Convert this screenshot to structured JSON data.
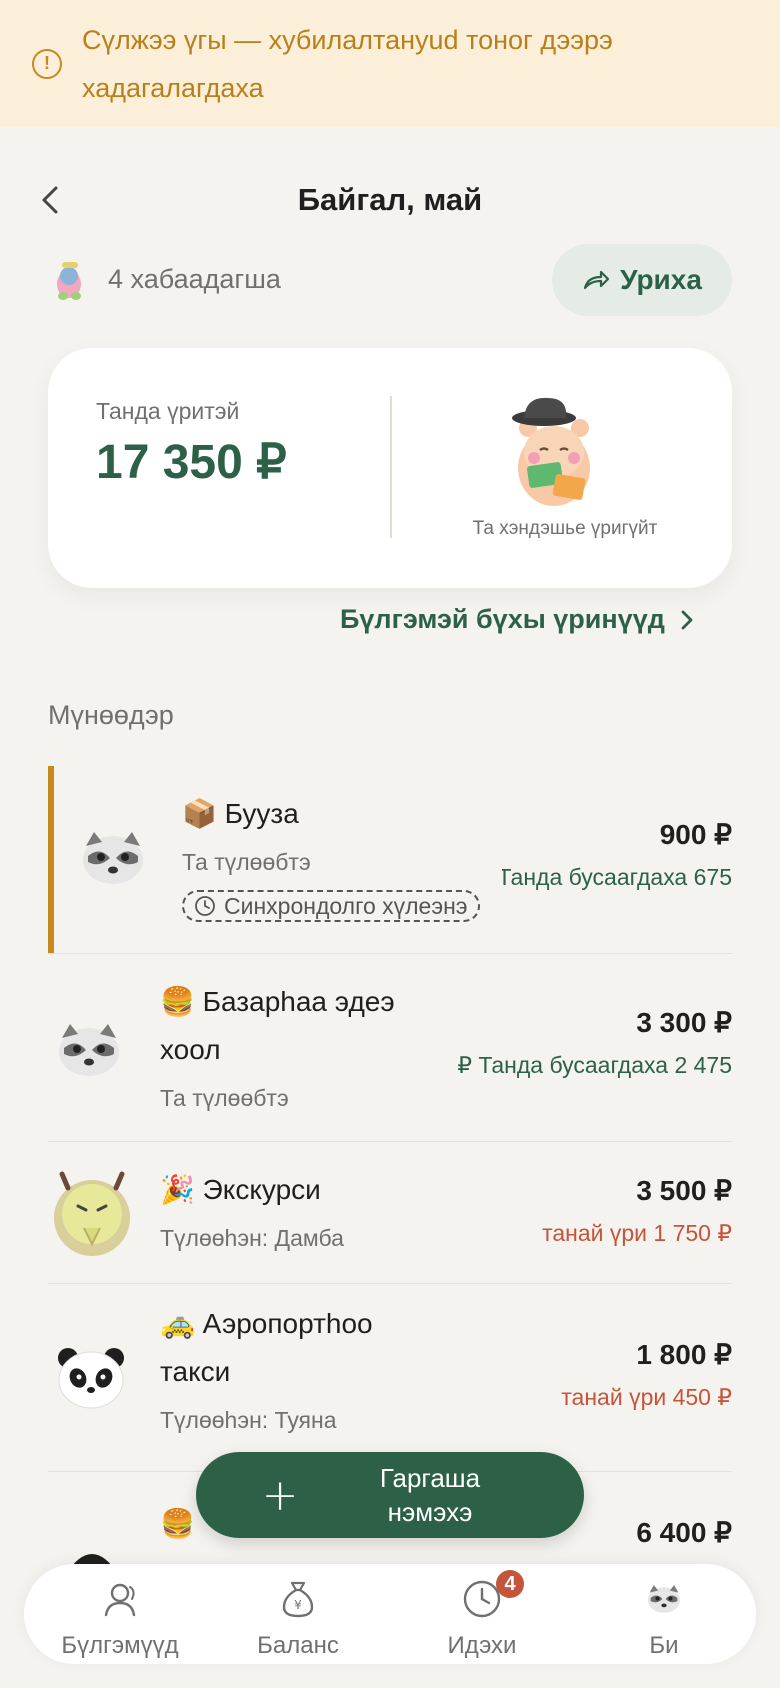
{
  "banner": {
    "icon": "alert-circle-icon",
    "text": "Сүлжээ үгы — хубилалтануud тоног дээрэ хадагалагдаха"
  },
  "header": {
    "title": "Байгал, май",
    "back_icon": "chevron-left-icon"
  },
  "members": {
    "count_label": "4 хабаадагша"
  },
  "invite": {
    "label": "Уриха",
    "icon": "share-arrow-icon"
  },
  "balance": {
    "label": "Танда үритэй",
    "amount": "17 350 ₽",
    "caption": "Та хэндэшье үригүйт"
  },
  "all_debts": {
    "label": "Бүлгэмэй бүхы үринүүд"
  },
  "section": {
    "title": "Мүнөөдэр"
  },
  "expenses": [
    {
      "emoji": "📦",
      "title": "Бууза",
      "payer": "Та түлөөбтэ",
      "amount": "900 ₽",
      "share": "Танда бусаагдаха 675 ₽",
      "pending": "Синхрондолго хүлеэнэ"
    },
    {
      "emoji": "🍔",
      "title_line1": "Базарhaa эдеэ",
      "title_line2": "хоол",
      "payer": "Та түлөөбтэ",
      "amount": "3 300 ₽",
      "share": "Танда бусаагдаха 2 475 ₽"
    },
    {
      "emoji": "🎉",
      "title": "Экскурси",
      "payer": "Түлөөhэн: Дамба",
      "amount": "3 500 ₽",
      "share": "танай үри 1 750 ₽"
    },
    {
      "emoji": "🚕",
      "title_line1": "Аэропортhoo",
      "title_line2": "такси",
      "payer": "Түлөөhэн: Туяна",
      "amount": "1 800 ₽",
      "share": "танай үри 450 ₽"
    },
    {
      "emoji": "🍔",
      "amount": "6 400 ₽"
    }
  ],
  "fab": {
    "line1": "Гаргаша",
    "line2": "нэмэхэ"
  },
  "tabs": [
    {
      "label": "Бүлгэмүүд",
      "icon": "people-icon"
    },
    {
      "label": "Баланс",
      "icon": "money-bag-icon"
    },
    {
      "label": "Идэхи",
      "icon": "clock-icon",
      "badge": "4"
    },
    {
      "label": "Би",
      "icon": "raccoon-avatar-icon"
    }
  ],
  "colors": {
    "accent": "#2c6148",
    "warning": "#c58a1e",
    "debt": "#c4553a",
    "background": "#f5f3ef"
  }
}
